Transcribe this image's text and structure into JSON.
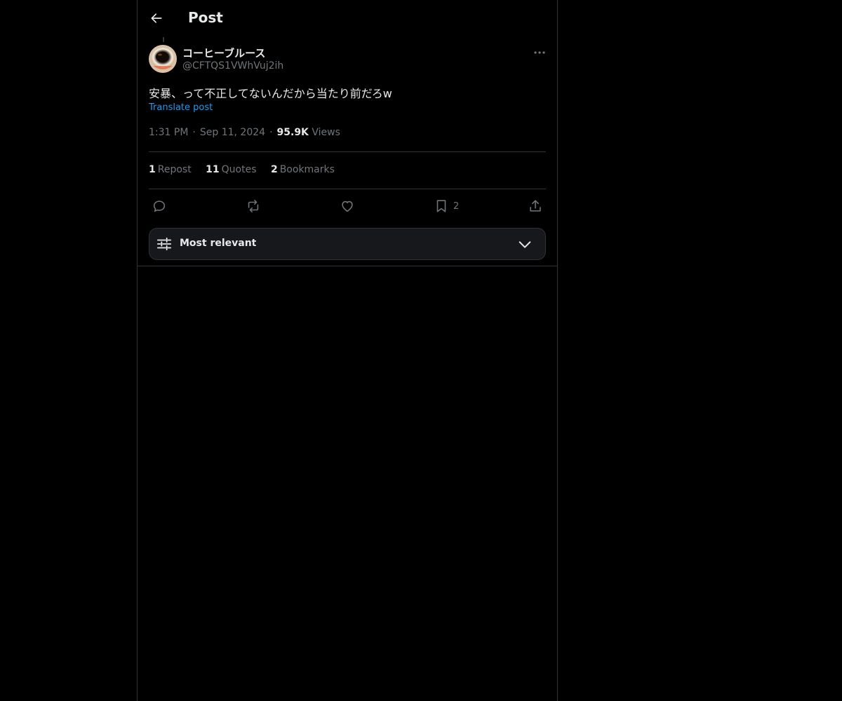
{
  "header": {
    "title": "Post",
    "back_icon": "arrow-left-icon"
  },
  "post": {
    "author": {
      "display_name": "コーヒーブルース",
      "handle": "@CFTQS1VWhVuj2ih",
      "avatar": "coffee-cup-avatar"
    },
    "text": "安暴、って不正してないんだから当たり前だろw",
    "translate_label": "Translate post",
    "time": "1:31 PM",
    "date": "Sep 11, 2024",
    "views_count": "95.9K",
    "views_label": "Views",
    "separator": "·"
  },
  "stats": {
    "reposts_count": "1",
    "reposts_label": "Repost",
    "quotes_count": "11",
    "quotes_label": "Quotes",
    "bookmarks_count": "2",
    "bookmarks_label": "Bookmarks"
  },
  "actions": {
    "bookmark_count": "2",
    "icons": [
      "reply-icon",
      "repost-icon",
      "like-icon",
      "bookmark-icon",
      "share-icon"
    ]
  },
  "sort": {
    "label": "Most relevant",
    "icon": "sliders-icon"
  },
  "colors": {
    "background": "#000000",
    "text_primary": "#e7e9ea",
    "text_secondary": "#71767b",
    "accent": "#1d9bf0",
    "border": "#2f3336"
  }
}
